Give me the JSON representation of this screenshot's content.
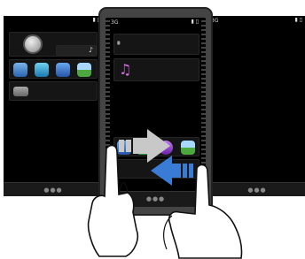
{
  "status": {
    "network": "3G"
  },
  "pager": {
    "left": "●●●",
    "center": "●●●",
    "right": "●●●"
  },
  "icons": {
    "contacts": "contacts-icon",
    "browser": "web-globe-icon",
    "mail": "mail-icon",
    "gallery": "photos-icon",
    "video": "video-icon",
    "music": "music-note-icon",
    "clock": "clock-icon",
    "chat": "message-bubble-icon"
  },
  "music_glyph": "♫",
  "small_note": "♪",
  "colors": {
    "screen_bg": "#000000",
    "phone_frame": "#444444",
    "arrow_right": "#c8c8c8",
    "arrow_left": "#3a7bd5",
    "accent_purple": "#d36ee0"
  }
}
